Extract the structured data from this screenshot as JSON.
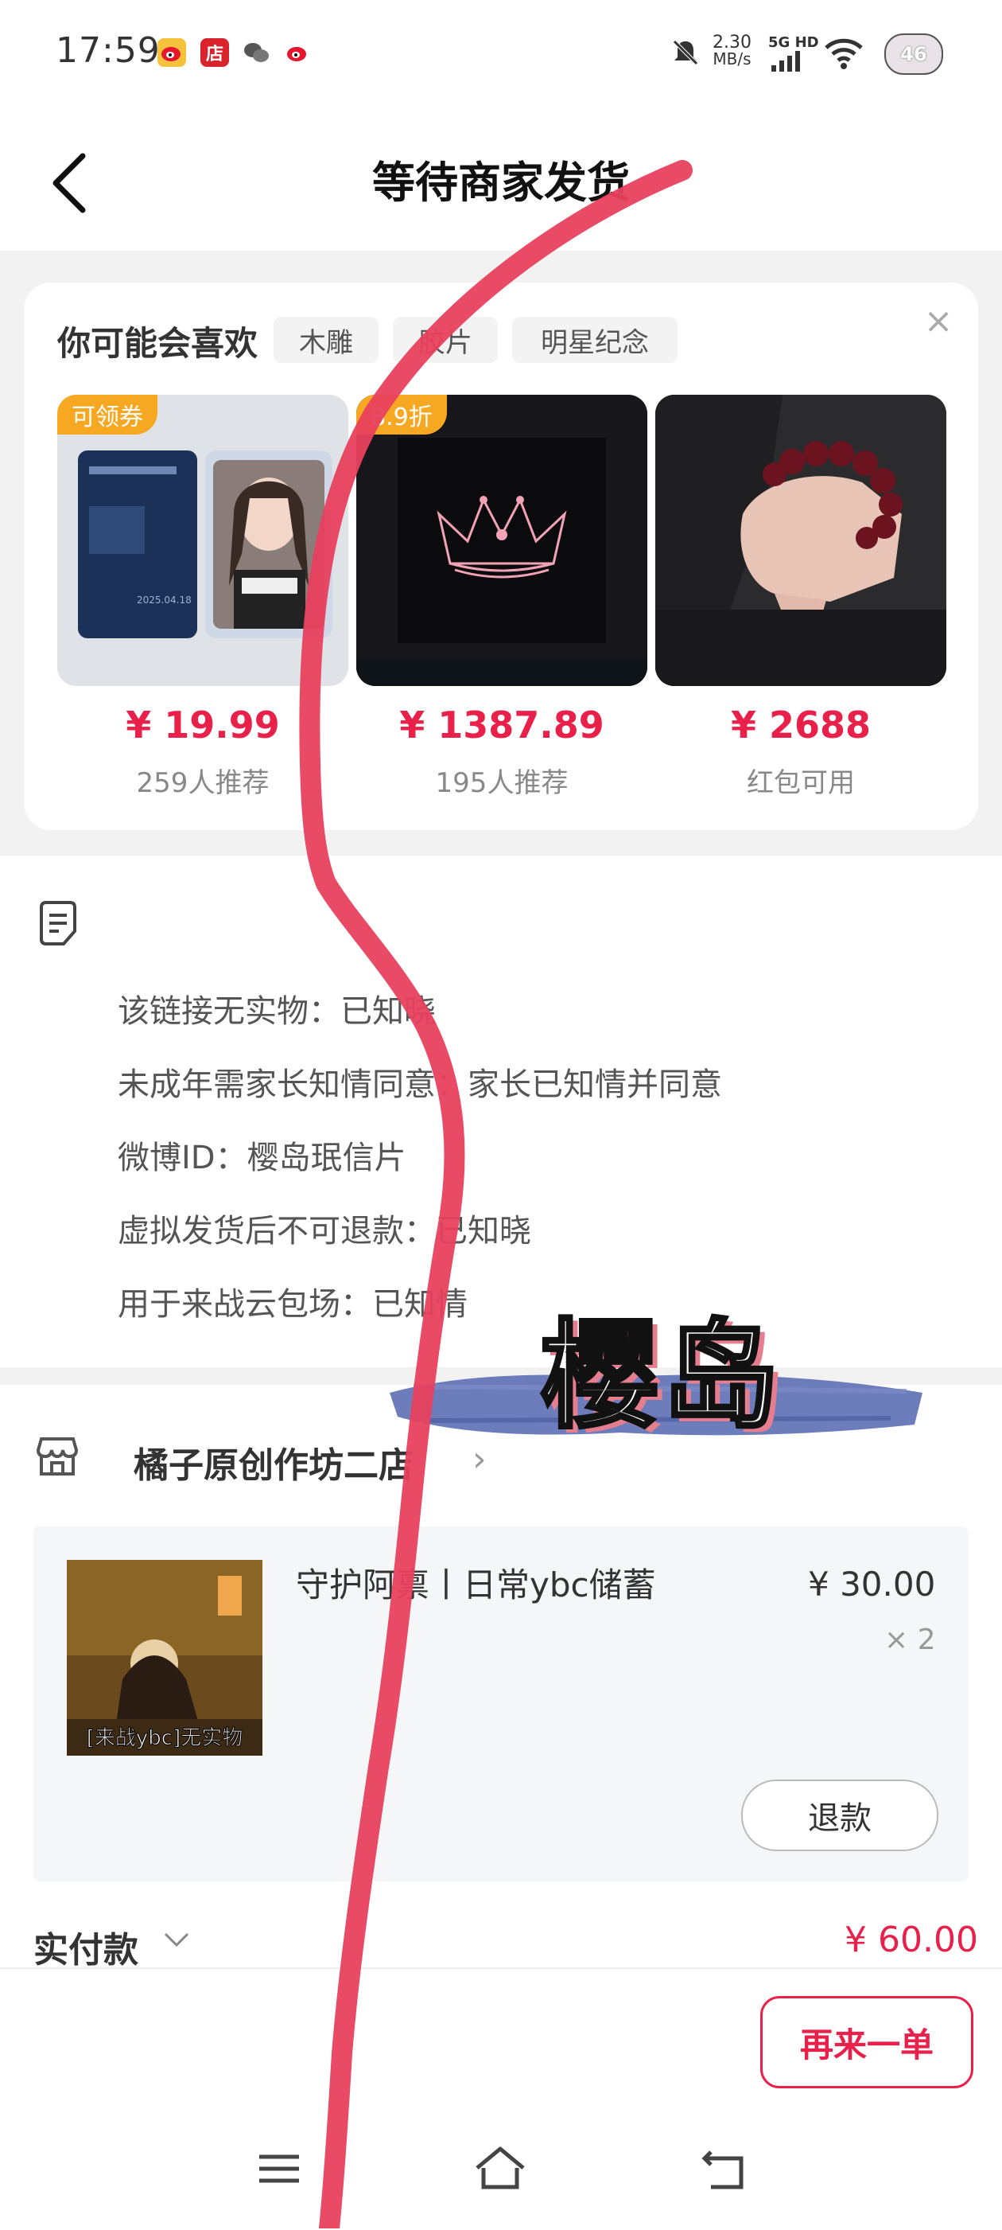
{
  "status_bar": {
    "time": "17:59",
    "net_speed_value": "2.30",
    "net_speed_unit": "MB/s",
    "network": "5G HD",
    "battery": "46",
    "icons": [
      "weibo-icon",
      "shop-icon",
      "wechat-icon",
      "weibo-icon",
      "mute-icon",
      "signal-icon",
      "wifi-icon"
    ]
  },
  "header": {
    "title": "等待商家发货"
  },
  "recommend": {
    "title": "你可能会喜欢",
    "chips": [
      "木雕",
      "胶片",
      "明星纪念"
    ],
    "items": [
      {
        "tag": "可领券",
        "price": "¥ 19.99",
        "sub": "259人推荐"
      },
      {
        "tag": "8.9折",
        "price": "¥ 1387.89",
        "sub": "195人推荐"
      },
      {
        "tag": "",
        "price": "¥ 2688",
        "sub": "红包可用"
      }
    ],
    "card1_date": "2025.04.18"
  },
  "notes": [
    "该链接无实物：已知晓",
    "未成年需家长知情同意：家长已知情并同意",
    "微博ID：樱岛珉信片",
    "虚拟发货后不可退款：已知晓",
    "用于来战云包场：已知情"
  ],
  "shop": {
    "name": "橘子原创作坊二店"
  },
  "order": {
    "title": "守护阿禀丨日常ybc储蓄",
    "thumb_caption": "[来战ybc]无实物",
    "price": "¥ 30.00",
    "qty": "× 2",
    "refund_label": "退款"
  },
  "payment": {
    "label": "实付款",
    "amount": "¥ 60.00"
  },
  "actions": {
    "reorder_label": "再来一单"
  },
  "overlay": {
    "sticker_text": "樱岛"
  },
  "colors": {
    "accent": "#e8204a",
    "tag": "#f7a823",
    "scribble": "#e8405e",
    "brush": "#5d6fb5"
  }
}
